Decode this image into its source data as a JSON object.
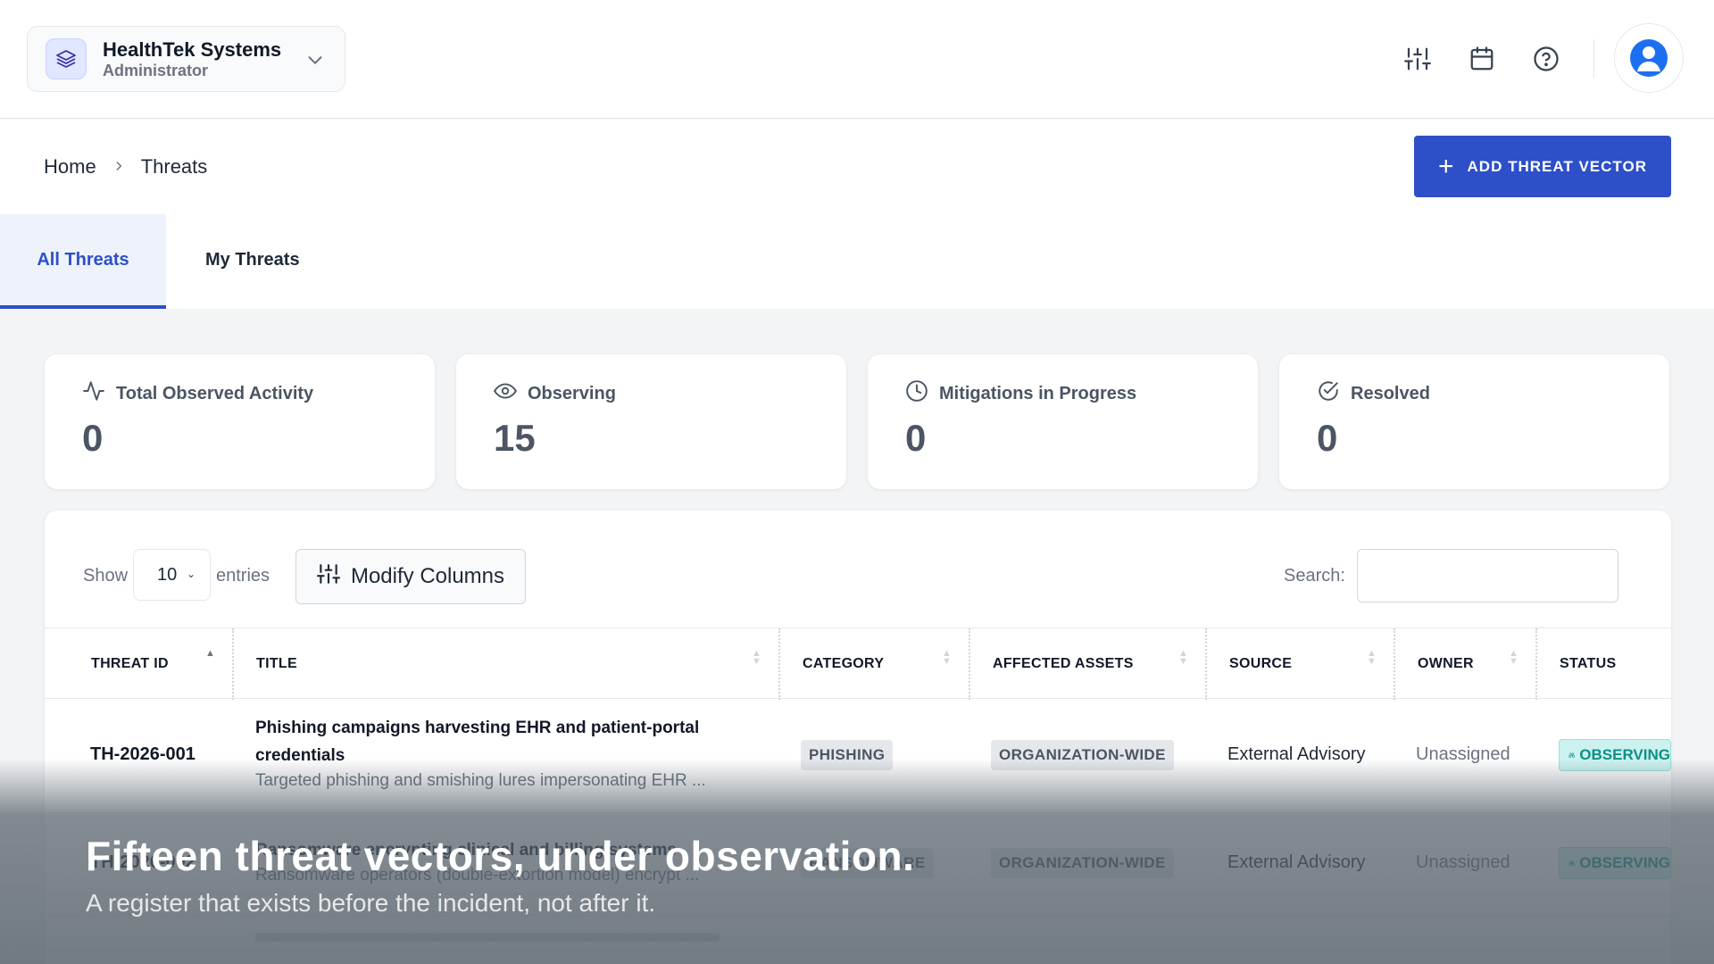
{
  "header": {
    "org_name": "HealthTek Systems",
    "org_role": "Administrator",
    "icons": [
      "sliders-icon",
      "calendar-icon",
      "help-circle-icon",
      "user-avatar-icon"
    ]
  },
  "breadcrumb": {
    "home": "Home",
    "current": "Threats"
  },
  "actions": {
    "add_label": "ADD THREAT VECTOR"
  },
  "tabs": [
    {
      "label": "All Threats",
      "active": true
    },
    {
      "label": "My Threats",
      "active": false
    }
  ],
  "stats": [
    {
      "label": "Total Observed Activity",
      "value": "0",
      "icon": "activity-icon"
    },
    {
      "label": "Observing",
      "value": "15",
      "icon": "eye-icon"
    },
    {
      "label": "Mitigations in Progress",
      "value": "0",
      "icon": "clock-icon"
    },
    {
      "label": "Resolved",
      "value": "0",
      "icon": "check-circle-icon"
    }
  ],
  "table": {
    "show_label": "Show",
    "entries_value": "10",
    "entries_label": "entries",
    "modify_columns_label": "Modify Columns",
    "search_label": "Search:",
    "search_value": "",
    "columns": [
      "THREAT ID",
      "TITLE",
      "CATEGORY",
      "AFFECTED ASSETS",
      "SOURCE",
      "OWNER",
      "STATUS"
    ],
    "rows": [
      {
        "id": "TH-2026-001",
        "title_line1": "Phishing campaigns harvesting EHR and patient-portal",
        "title_line2": "credentials",
        "description": "Targeted phishing and smishing lures impersonating EHR ...",
        "category": "PHISHING",
        "assets": "ORGANIZATION-WIDE",
        "source": "External Advisory",
        "owner": "Unassigned",
        "status": "OBSERVING"
      },
      {
        "id": "TH-2026-002",
        "title_line1": "Ransomware encrypting clinical and billing systems",
        "title_line2": "",
        "description": "Ransomware operators (double-extortion model) encrypt ...",
        "category": "RANSOMWARE",
        "assets": "ORGANIZATION-WIDE",
        "source": "External Advisory",
        "owner": "Unassigned",
        "status": "OBSERVING"
      }
    ]
  },
  "caption": {
    "title": "Fifteen threat vectors, under observation.",
    "subtitle": "A register that exists before the incident, not after it."
  },
  "colors": {
    "primary": "#2d4fc8",
    "status_teal": "#0e8f86",
    "avatar_blue": "#1d6ff2"
  }
}
